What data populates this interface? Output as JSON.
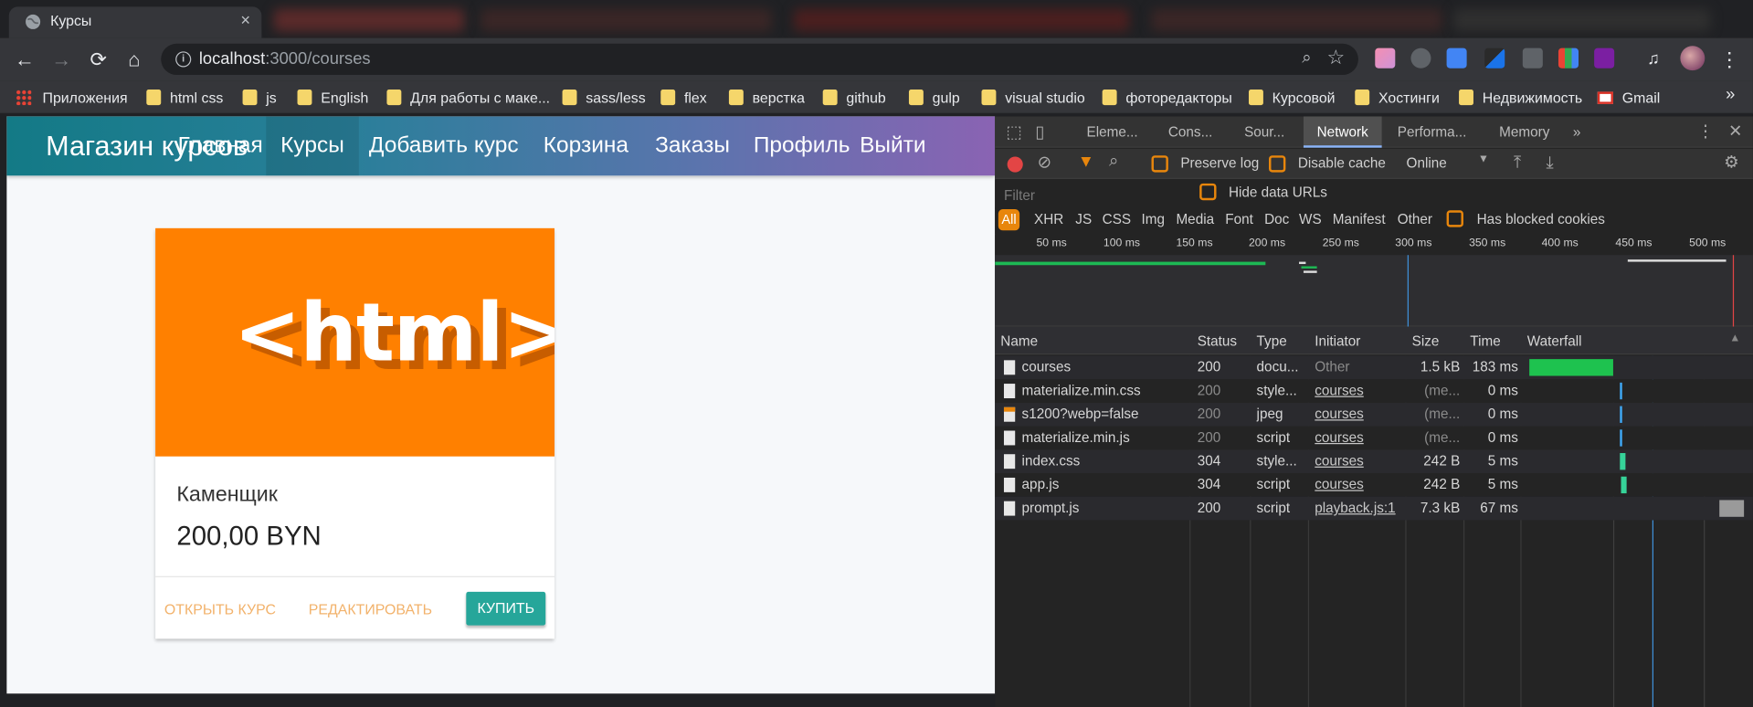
{
  "browser": {
    "tab_title": "Курсы",
    "tab_close": "×",
    "url_host": "localhost",
    "url_path": ":3000/courses",
    "bookmarks": [
      "Приложения",
      "html css",
      "js",
      "English",
      "Для работы с маке...",
      "sass/less",
      "flex",
      "верстка",
      "github",
      "gulp",
      "visual studio",
      "фоторедакторы",
      "Курсовой",
      "Хостинги",
      "Недвижимость",
      "Gmail"
    ],
    "bookmarks_more": "»"
  },
  "site": {
    "brand": "Магазин курсов",
    "nav": [
      "Главная",
      "Курсы",
      "Добавить курс",
      "Корзина",
      "Заказы",
      "Профиль",
      "Выйти"
    ],
    "card": {
      "image_text": "<html>",
      "title": "Каменщик",
      "price": "200,00 BYN",
      "open_label": "ОТКРЫТЬ КУРС",
      "edit_label": "РЕДАКТИРОВАТЬ",
      "buy_label": "КУПИТЬ"
    },
    "colors": {
      "navbar_start": "#137a86",
      "navbar_end": "#8a63b3",
      "card_image": "#ff8000",
      "buy_button": "#26a69a",
      "action_link": "#f2b26b"
    }
  },
  "devtools": {
    "tabs": [
      "Eleme...",
      "Cons...",
      "Sour...",
      "Network",
      "Performa...",
      "Memory"
    ],
    "active_tab": "Network",
    "more_tabs": "»",
    "preserve_log": "Preserve log",
    "disable_cache": "Disable cache",
    "throttle": "Online",
    "filter_placeholder": "Filter",
    "hide_data_urls": "Hide data URLs",
    "types": [
      "All",
      "XHR",
      "JS",
      "CSS",
      "Img",
      "Media",
      "Font",
      "Doc",
      "WS",
      "Manifest",
      "Other"
    ],
    "blocked_cookies": "Has blocked cookies",
    "timeline_ticks": [
      "50 ms",
      "100 ms",
      "150 ms",
      "200 ms",
      "250 ms",
      "300 ms",
      "350 ms",
      "400 ms",
      "450 ms",
      "500 ms"
    ],
    "columns": [
      "Name",
      "Status",
      "Type",
      "Initiator",
      "Size",
      "Time",
      "Waterfall"
    ],
    "rows": [
      {
        "name": "courses",
        "status": "200",
        "type": "docu...",
        "initiator": "Other",
        "size": "1.5 kB",
        "time": "183 ms"
      },
      {
        "name": "materialize.min.css",
        "status": "200",
        "type": "style...",
        "initiator": "courses",
        "size": "(me...",
        "time": "0 ms"
      },
      {
        "name": "s1200?webp=false",
        "status": "200",
        "type": "jpeg",
        "initiator": "courses",
        "size": "(me...",
        "time": "0 ms"
      },
      {
        "name": "materialize.min.js",
        "status": "200",
        "type": "script",
        "initiator": "courses",
        "size": "(me...",
        "time": "0 ms"
      },
      {
        "name": "index.css",
        "status": "304",
        "type": "style...",
        "initiator": "courses",
        "size": "242 B",
        "time": "5 ms"
      },
      {
        "name": "app.js",
        "status": "304",
        "type": "script",
        "initiator": "courses",
        "size": "242 B",
        "time": "5 ms"
      },
      {
        "name": "prompt.js",
        "status": "200",
        "type": "script",
        "initiator": "playback.js:1",
        "size": "7.3 kB",
        "time": "67 ms"
      }
    ]
  }
}
